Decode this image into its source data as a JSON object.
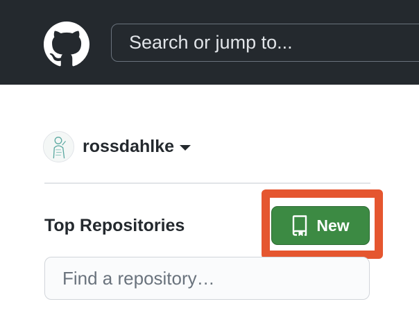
{
  "header": {
    "logo_icon": "github-octocat-icon",
    "search_placeholder": "Search or jump to..."
  },
  "account": {
    "username": "rossdahlke",
    "avatar_icon": "user-avatar-icon",
    "dropdown_icon": "caret-down-icon"
  },
  "repositories": {
    "title": "Top Repositories",
    "new_button_label": "New",
    "new_button_icon": "repo-icon",
    "find_placeholder": "Find a repository…"
  },
  "colors": {
    "header_bg": "#24292e",
    "primary_button": "#3c8a43",
    "highlight": "#e5562f"
  }
}
